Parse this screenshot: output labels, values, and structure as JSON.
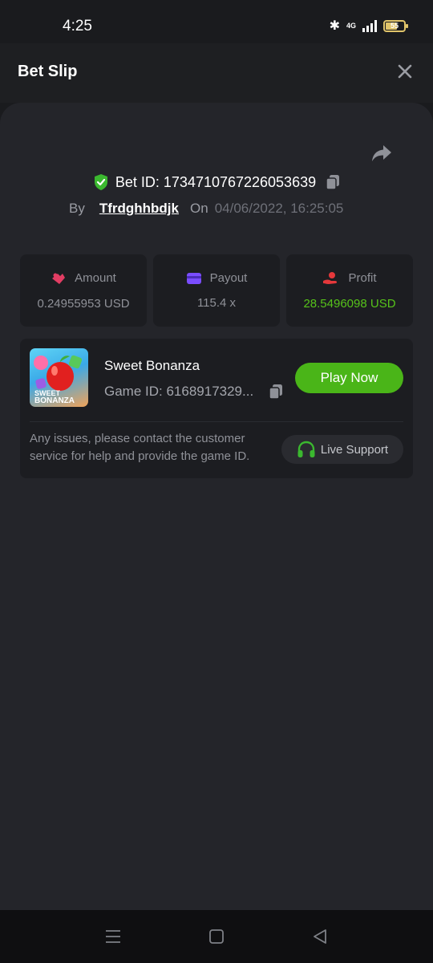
{
  "status_bar": {
    "time": "4:25",
    "network": "4G",
    "battery": "55"
  },
  "header": {
    "title": "Bet Slip"
  },
  "bet": {
    "id_label": "Bet ID: 1734710767226053639",
    "by_label": "By",
    "username": "Tfrdghhbdjk",
    "on_label": "On",
    "datetime": "04/06/2022, 16:25:05"
  },
  "stats": [
    {
      "label": "Amount",
      "value": "0.24955953 USD",
      "icon": "amount-icon"
    },
    {
      "label": "Payout",
      "value": "115.4 x",
      "icon": "payout-card-icon"
    },
    {
      "label": "Profit",
      "value": "28.5496098 USD",
      "icon": "profit-icon"
    }
  ],
  "game": {
    "name": "Sweet Bonanza",
    "id_label": "Game ID: 6168917329...",
    "play_label": "Play Now",
    "thumb_text_line1": "SWEET",
    "thumb_text_line2": "BONANZA"
  },
  "support": {
    "help_text": "Any issues, please contact the customer service for help and provide the game ID.",
    "button_label": "Live Support"
  },
  "colors": {
    "accent_green": "#4ab518",
    "profit_green": "#56c21a",
    "amount_icon": "#e23d63",
    "payout_icon": "#7a4dff",
    "profit_icon": "#e5383b"
  }
}
